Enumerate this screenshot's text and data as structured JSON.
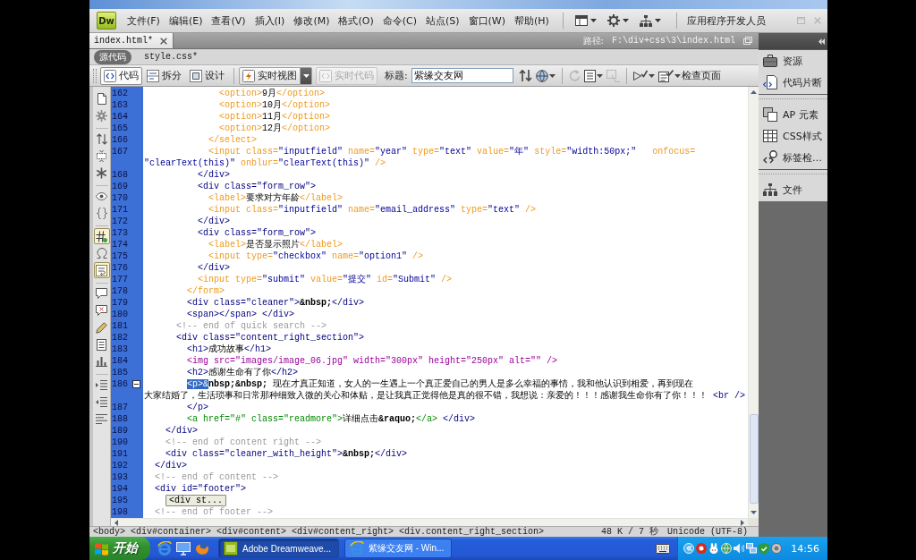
{
  "window": {
    "logo": "Dw",
    "menus": [
      "文件(F)",
      "编辑(E)",
      "查看(V)",
      "插入(I)",
      "修改(M)",
      "格式(O)",
      "命令(C)",
      "站点(S)",
      "窗口(W)",
      "帮助(H)"
    ],
    "workspace": "应用程序开发人员"
  },
  "document_tabs": [
    {
      "label": "index.html*",
      "selected": true
    }
  ],
  "path": {
    "label": "路径:",
    "value": "F:\\div+css\\3\\index.html"
  },
  "related_files": [
    {
      "label": "源代码",
      "selected": true
    },
    {
      "label": "style.css*",
      "selected": false
    }
  ],
  "doc_toolbar": {
    "views": [
      {
        "label": "代码",
        "selected": true
      },
      {
        "label": "拆分",
        "selected": false
      },
      {
        "label": "设计",
        "selected": false
      }
    ],
    "live_view": "实时视图",
    "live_code": {
      "label": "实时代码",
      "disabled": true
    },
    "title_label": "标题:",
    "title_value": "紫缘交友网",
    "tools": [
      {
        "disabled": false
      },
      {
        "disabled": false
      },
      {
        "disabled": true
      },
      {
        "disabled": false
      },
      {
        "disabled": true
      },
      {
        "disabled": false
      },
      {
        "disabled": false,
        "label": "检查页面"
      }
    ]
  },
  "coding_toolbar": [
    {
      "on": false
    },
    {
      "on": false
    },
    {
      "on": false
    },
    {
      "on": false
    },
    {
      "on": false
    },
    {
      "on": false
    },
    {
      "on": false
    },
    {
      "on": true
    },
    {
      "on": false
    },
    {
      "on": true
    },
    {
      "on": false
    },
    {
      "on": false
    },
    {
      "on": false
    },
    {
      "on": false
    },
    {
      "on": false
    },
    {
      "on": false
    },
    {
      "on": false
    },
    {
      "on": false
    }
  ],
  "code_rows": [
    {
      "number": "162",
      "segments": [
        {
          "kind": "form",
          "text": "              <option>"
        },
        {
          "kind": "text",
          "text": "9月"
        },
        {
          "kind": "form",
          "text": "</option>"
        }
      ]
    },
    {
      "number": "163",
      "segments": [
        {
          "kind": "form",
          "text": "              <option>"
        },
        {
          "kind": "text",
          "text": "10月"
        },
        {
          "kind": "form",
          "text": "</option>"
        }
      ]
    },
    {
      "number": "164",
      "segments": [
        {
          "kind": "form",
          "text": "              <option>"
        },
        {
          "kind": "text",
          "text": "11月"
        },
        {
          "kind": "form",
          "text": "</option>"
        }
      ]
    },
    {
      "number": "165",
      "segments": [
        {
          "kind": "form",
          "text": "              <option>"
        },
        {
          "kind": "text",
          "text": "12月"
        },
        {
          "kind": "form",
          "text": "</option>"
        }
      ]
    },
    {
      "number": "166",
      "segments": [
        {
          "kind": "form",
          "text": "            </select>"
        }
      ]
    },
    {
      "number": "167",
      "segments": [
        {
          "kind": "form",
          "text": "            <input class=\"inputfield\" name=\"year\" type=\"text\" value=\"年\" style=\"width:50px;\"   onfocus="
        }
      ]
    },
    {
      "segments": [
        {
          "kind": "form",
          "text": "\"clearText(this)\" onblur=\"clearText(this)\" />"
        }
      ]
    },
    {
      "number": "168",
      "segments": [
        {
          "kind": "tag",
          "text": "          </div>"
        }
      ]
    },
    {
      "number": "169",
      "segments": [
        {
          "kind": "tag",
          "text": "          <div class=\"form_row\">"
        }
      ]
    },
    {
      "number": "170",
      "segments": [
        {
          "kind": "form",
          "text": "            <label>"
        },
        {
          "kind": "text",
          "text": "要求对方年龄"
        },
        {
          "kind": "form",
          "text": "</label>"
        }
      ]
    },
    {
      "number": "171",
      "segments": [
        {
          "kind": "form",
          "text": "            <input class=\"inputfield\" name=\"email_address\" type=\"text\" />"
        }
      ]
    },
    {
      "number": "172",
      "segments": [
        {
          "kind": "tag",
          "text": "          </div>"
        }
      ]
    },
    {
      "number": "173",
      "segments": [
        {
          "kind": "tag",
          "text": "          <div class=\"form_row\">"
        }
      ]
    },
    {
      "number": "174",
      "segments": [
        {
          "kind": "form",
          "text": "            <label>"
        },
        {
          "kind": "text",
          "text": "是否显示照片"
        },
        {
          "kind": "form",
          "text": "</label>"
        }
      ]
    },
    {
      "number": "175",
      "segments": [
        {
          "kind": "form",
          "text": "            <input type=\"checkbox\" name=\"option1\" />"
        }
      ]
    },
    {
      "number": "176",
      "segments": [
        {
          "kind": "tag",
          "text": "          </div>"
        }
      ]
    },
    {
      "number": "177",
      "segments": [
        {
          "kind": "form",
          "text": "          <input type=\"submit\" value=\"提交\" id=\"Submit\" />"
        }
      ]
    },
    {
      "number": "178",
      "segments": [
        {
          "kind": "form",
          "text": "        </form>"
        }
      ]
    },
    {
      "number": "179",
      "segments": [
        {
          "kind": "tag",
          "text": "        <div class=\"cleaner\">"
        },
        {
          "kind": "entity",
          "text": "&nbsp;"
        },
        {
          "kind": "tag",
          "text": "</div>"
        }
      ]
    },
    {
      "number": "180",
      "segments": [
        {
          "kind": "tag",
          "text": "        <span></span> </div>"
        }
      ]
    },
    {
      "number": "181",
      "segments": [
        {
          "kind": "comment",
          "text": "      <!-- end of quick search -->"
        }
      ]
    },
    {
      "number": "182",
      "segments": [
        {
          "kind": "tag",
          "text": "      <div class=\"content_right_section\">"
        }
      ]
    },
    {
      "number": "183",
      "segments": [
        {
          "kind": "tag",
          "text": "        <h1>"
        },
        {
          "kind": "text",
          "text": "成功故事"
        },
        {
          "kind": "tag",
          "text": "</h1>"
        }
      ]
    },
    {
      "number": "184",
      "segments": [
        {
          "kind": "image",
          "text": "        <img src=\"images/image_06.jpg\" width=\"300px\" height=\"250px\" alt=\"\" />"
        }
      ]
    },
    {
      "number": "185",
      "segments": [
        {
          "kind": "tag",
          "text": "        <h2>"
        },
        {
          "kind": "text",
          "text": "感谢生命有了你"
        },
        {
          "kind": "tag",
          "text": "</h2>"
        }
      ]
    },
    {
      "number": "186",
      "fold": true,
      "segments": [
        {
          "kind": "selection",
          "text": "        <p>&"
        },
        {
          "kind": "entity",
          "text": "nbsp;&nbsp;"
        },
        {
          "kind": "text",
          "text": " 现在才真正知道，女人的一生遇上一个真正爱自己的男人是多么幸福的事情，我和他认识到相爱，再到现在"
        }
      ]
    },
    {
      "segments": [
        {
          "kind": "text",
          "text": "大家结婚了，生活琐事和日常那种细致入微的关心和体贴，是让我真正觉得他是真的很不错，我想说：亲爱的！！！感谢我生命你有了你！！！ "
        },
        {
          "kind": "tag",
          "text": "<br />"
        }
      ]
    },
    {
      "number": "187",
      "segments": [
        {
          "kind": "tag",
          "text": "        </p>"
        }
      ]
    },
    {
      "number": "188",
      "segments": [
        {
          "kind": "link",
          "text": "        <a href=\"#\" class=\"readmore\">"
        },
        {
          "kind": "text",
          "text": "详细点击"
        },
        {
          "kind": "entity",
          "text": "&raquo;"
        },
        {
          "kind": "link",
          "text": "</a>"
        },
        {
          "kind": "tag",
          "text": " </div>"
        }
      ]
    },
    {
      "number": "189",
      "segments": [
        {
          "kind": "tag",
          "text": "    </div>"
        }
      ]
    },
    {
      "number": "190",
      "segments": [
        {
          "kind": "comment",
          "text": "    <!-- end of content right -->"
        }
      ]
    },
    {
      "number": "191",
      "segments": [
        {
          "kind": "tag",
          "text": "    <div class=\"cleaner_with_height\">"
        },
        {
          "kind": "entity",
          "text": "&nbsp;"
        },
        {
          "kind": "tag",
          "text": "</div>"
        }
      ]
    },
    {
      "number": "192",
      "segments": [
        {
          "kind": "tag",
          "text": "  </div>"
        }
      ]
    },
    {
      "number": "193",
      "segments": [
        {
          "kind": "comment",
          "text": "  <!-- end of content -->"
        }
      ]
    },
    {
      "number": "194",
      "segments": [
        {
          "kind": "tag",
          "text": "  <div id=\"footer\">"
        }
      ]
    },
    {
      "number": "195",
      "segments": [
        {
          "kind": "collapsed",
          "text": "    <div st..."
        }
      ]
    },
    {
      "number": "198",
      "segments": [
        {
          "kind": "comment",
          "text": "  <!-- end of footer -->"
        }
      ]
    }
  ],
  "tag_selector": [
    "<body>",
    "<div#container>",
    "<div#content>",
    "<div#content_right>",
    "<div.content_right_section>"
  ],
  "status": {
    "size": "48 K / 7 秒",
    "encoding": "Unicode (UTF-8)"
  },
  "panel_groups": [
    {
      "items": [
        "资源",
        "代码片断"
      ]
    },
    {
      "items": [
        "AP 元素",
        "CSS样式",
        "标签检…"
      ]
    },
    {
      "items": [
        "文件"
      ]
    }
  ],
  "taskbar": {
    "start": "开始",
    "tasks": [
      {
        "label": "Adobe Dreamweave...",
        "selected": true
      },
      {
        "label": "紫缘交友网 - Win...",
        "selected": false
      }
    ],
    "clock": "14:56"
  }
}
